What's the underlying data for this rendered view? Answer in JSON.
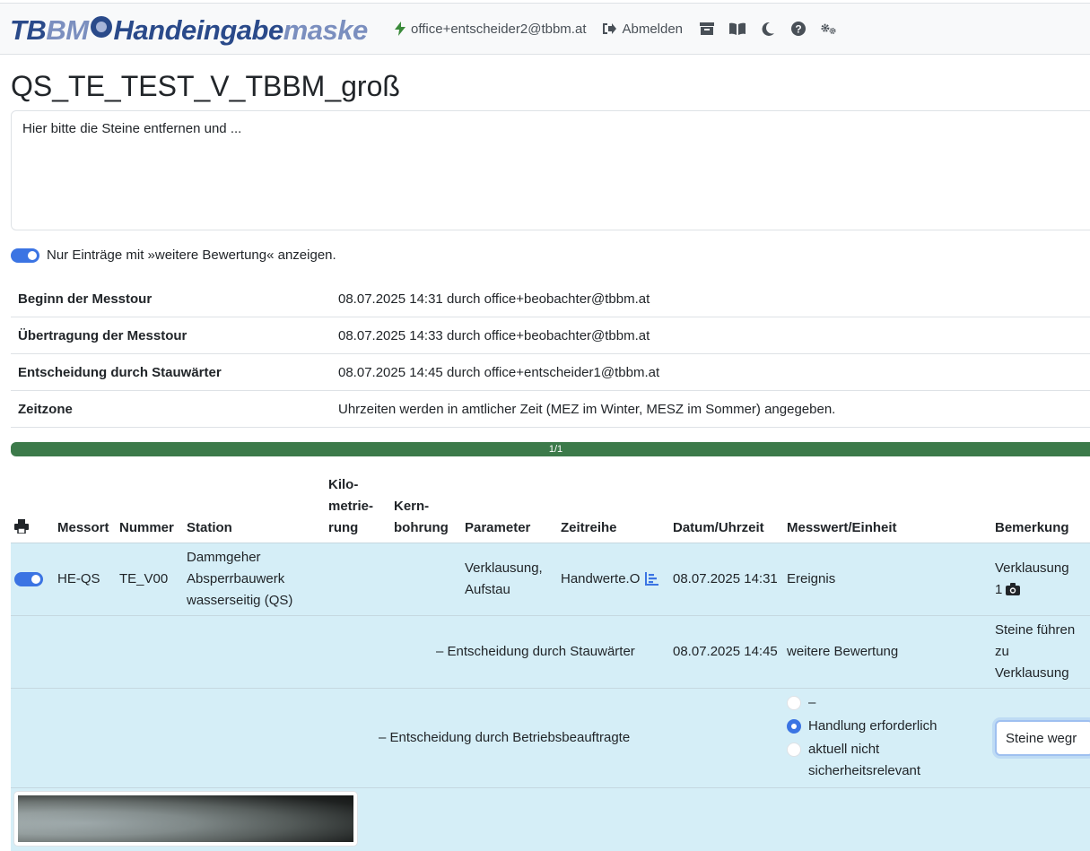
{
  "app": {
    "logo_part1": "TB",
    "logo_part2": "BM",
    "logo_part3": "Handeingabe",
    "logo_part4": "maske"
  },
  "navbar": {
    "user_email": "office+entscheider2@tbbm.at",
    "logout_label": "Abmelden",
    "icons": [
      "archive-icon",
      "book-icon",
      "moon-icon",
      "help-icon",
      "settings-icon"
    ]
  },
  "page": {
    "title": "QS_TE_TEST_V_TBBM_groß",
    "comment_text": "Hier bitte die Steine entfernen und ...",
    "filter_label": "Nur Einträge mit »weitere Bewertung« anzeigen.",
    "filter_enabled": true
  },
  "info": [
    {
      "label": "Beginn der Messtour",
      "value": "08.07.2025 14:31 durch office+beobachter@tbbm.at"
    },
    {
      "label": "Übertragung der Messtour",
      "value": "08.07.2025 14:33 durch office+beobachter@tbbm.at"
    },
    {
      "label": "Entscheidung durch Stauwärter",
      "value": "08.07.2025 14:45 durch office+entscheider1@tbbm.at"
    },
    {
      "label": "Zeitzone",
      "value": "Uhrzeiten werden in amtlicher Zeit (MEZ im Winter, MESZ im Sommer) angegeben."
    }
  ],
  "progress": {
    "label": "1/1",
    "percent": 100
  },
  "table": {
    "headers": {
      "messort": "Messort",
      "nummer": "Nummer",
      "station": "Station",
      "km_1": "Kilo-",
      "km_2": "metrie-",
      "km_3": "rung",
      "kern_1": "Kern-",
      "kern_2": "bohrung",
      "parameter": "Parameter",
      "zeitreihe": "Zeitreihe",
      "datum": "Datum/Uhrzeit",
      "messwert": "Messwert/Einheit",
      "bemerkung": "Bemerkung"
    },
    "row": {
      "messort": "HE-QS",
      "nummer": "TE_V00",
      "station_1": "Dammgeher",
      "station_2": "Absperrbauwerk",
      "station_3": "wasserseitig (QS)",
      "parameter_1": "Verklausung,",
      "parameter_2": "Aufstau",
      "zeitreihe": "Handwerte.O",
      "datum": "08.07.2025 14:31",
      "messwert": "Ereignis",
      "bemerkung_1": "Verklausung",
      "bemerkung_2": "1"
    },
    "decision_stauwaerter": {
      "label": "– Entscheidung durch Stauwärter",
      "datum": "08.07.2025 14:45",
      "messwert": "weitere Bewertung",
      "bemerkung_1": "Steine führen",
      "bemerkung_2": "zu",
      "bemerkung_3": "Verklausung"
    },
    "decision_betrieb": {
      "label": "– Entscheidung durch Betriebsbeauftragte",
      "options": [
        {
          "label": "–",
          "checked": false
        },
        {
          "label": "Handlung erforderlich",
          "checked": true
        },
        {
          "label_1": "aktuell nicht",
          "label_2": "sicherheitsrelevant",
          "checked": false
        }
      ],
      "remark_value": "Steine wegr"
    }
  }
}
